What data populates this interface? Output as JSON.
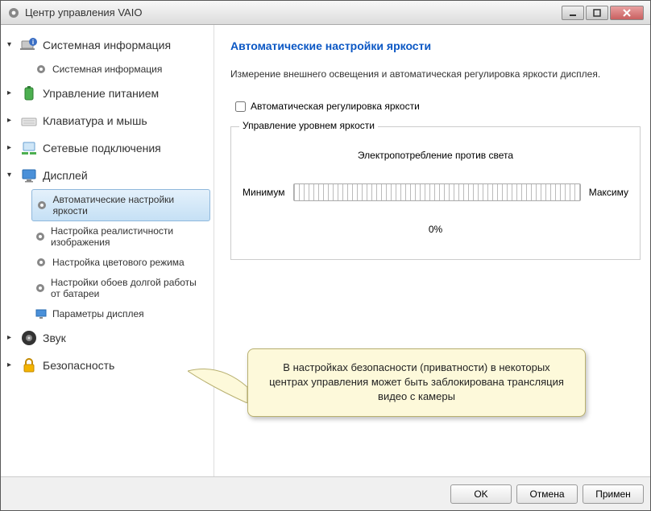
{
  "window": {
    "title": "Центр управления VAIO"
  },
  "sidebar": {
    "items": [
      {
        "label": "Системная информация",
        "expanded": true,
        "children": [
          {
            "label": "Системная информация"
          }
        ]
      },
      {
        "label": "Управление питанием"
      },
      {
        "label": "Клавиатура и мышь"
      },
      {
        "label": "Сетевые подключения"
      },
      {
        "label": "Дисплей",
        "expanded": true,
        "children": [
          {
            "label": "Автоматические настройки яркости",
            "selected": true
          },
          {
            "label": "Настройка реалистичности изображения"
          },
          {
            "label": "Настройка цветового режима"
          },
          {
            "label": "Настройки обоев долгой работы от батареи"
          },
          {
            "label": "Параметры дисплея"
          }
        ]
      },
      {
        "label": "Звук"
      },
      {
        "label": "Безопасность"
      }
    ]
  },
  "main": {
    "heading": "Автоматические настройки яркости",
    "description": "Измерение внешнего освещения и автоматическая регулировка яркости дисплея.",
    "checkbox_label": "Автоматическая регулировка яркости",
    "fieldset_legend": "Управление уровнем яркости",
    "tradeoff_label": "Электропотребление против света",
    "min_label": "Минимум",
    "max_label": "Максиму",
    "percent": "0%"
  },
  "callout": {
    "text": "В настройках безопасности (приватности) в некоторых центрах управления может быть заблокирована трансляция видео с камеры"
  },
  "footer": {
    "ok": "OK",
    "cancel": "Отмена",
    "apply": "Примен"
  }
}
